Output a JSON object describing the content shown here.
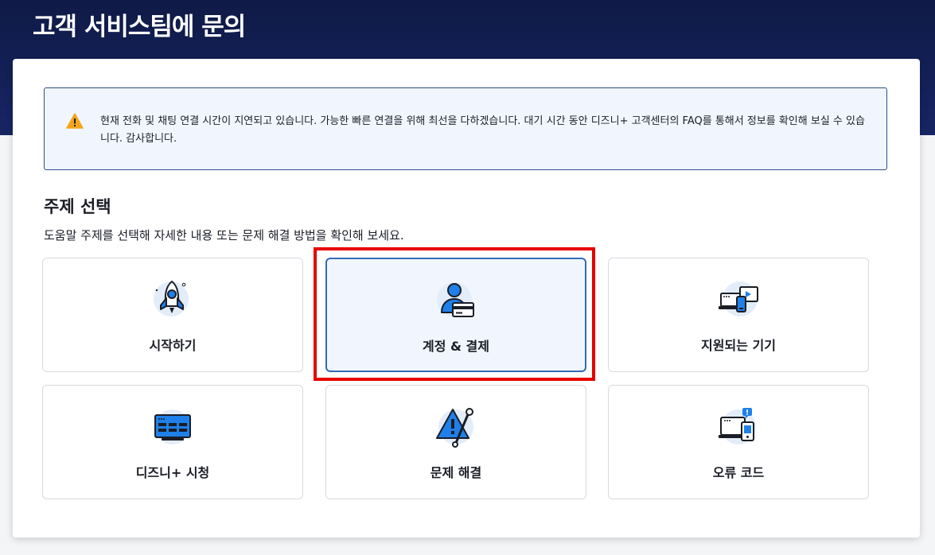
{
  "header": {
    "title": "고객 서비스팀에 문의"
  },
  "notice": {
    "icon": "warning-icon",
    "text": "현재 전화 및 채팅 연결 시간이 지연되고 있습니다. 가능한 빠른 연결을 위해 최선을 다하겠습니다. 대기 시간 동안 디즈니+ 고객센터의 FAQ를 통해서 정보를 확인해 보실 수 있습니다. 감사합니다."
  },
  "topics": {
    "title": "주제 선택",
    "description": "도움말 주제를 선택해 자세한 내용 또는 문제 해결 방법을 확인해 보세요.",
    "items": [
      {
        "label": "시작하기",
        "icon": "rocket-icon"
      },
      {
        "label": "계정 & 결제",
        "icon": "account-billing-icon",
        "selected": true
      },
      {
        "label": "지원되는 기기",
        "icon": "devices-icon"
      },
      {
        "label": "디즈니+ 시청",
        "icon": "tv-grid-icon"
      },
      {
        "label": "문제 해결",
        "icon": "troubleshoot-icon"
      },
      {
        "label": "오류 코드",
        "icon": "error-code-icon"
      }
    ]
  },
  "colors": {
    "header_bg": "#172564",
    "accent": "#2f6db5",
    "icon_blue": "#1e80e8",
    "highlight": "#e70000",
    "warning": "#f2a51c"
  }
}
